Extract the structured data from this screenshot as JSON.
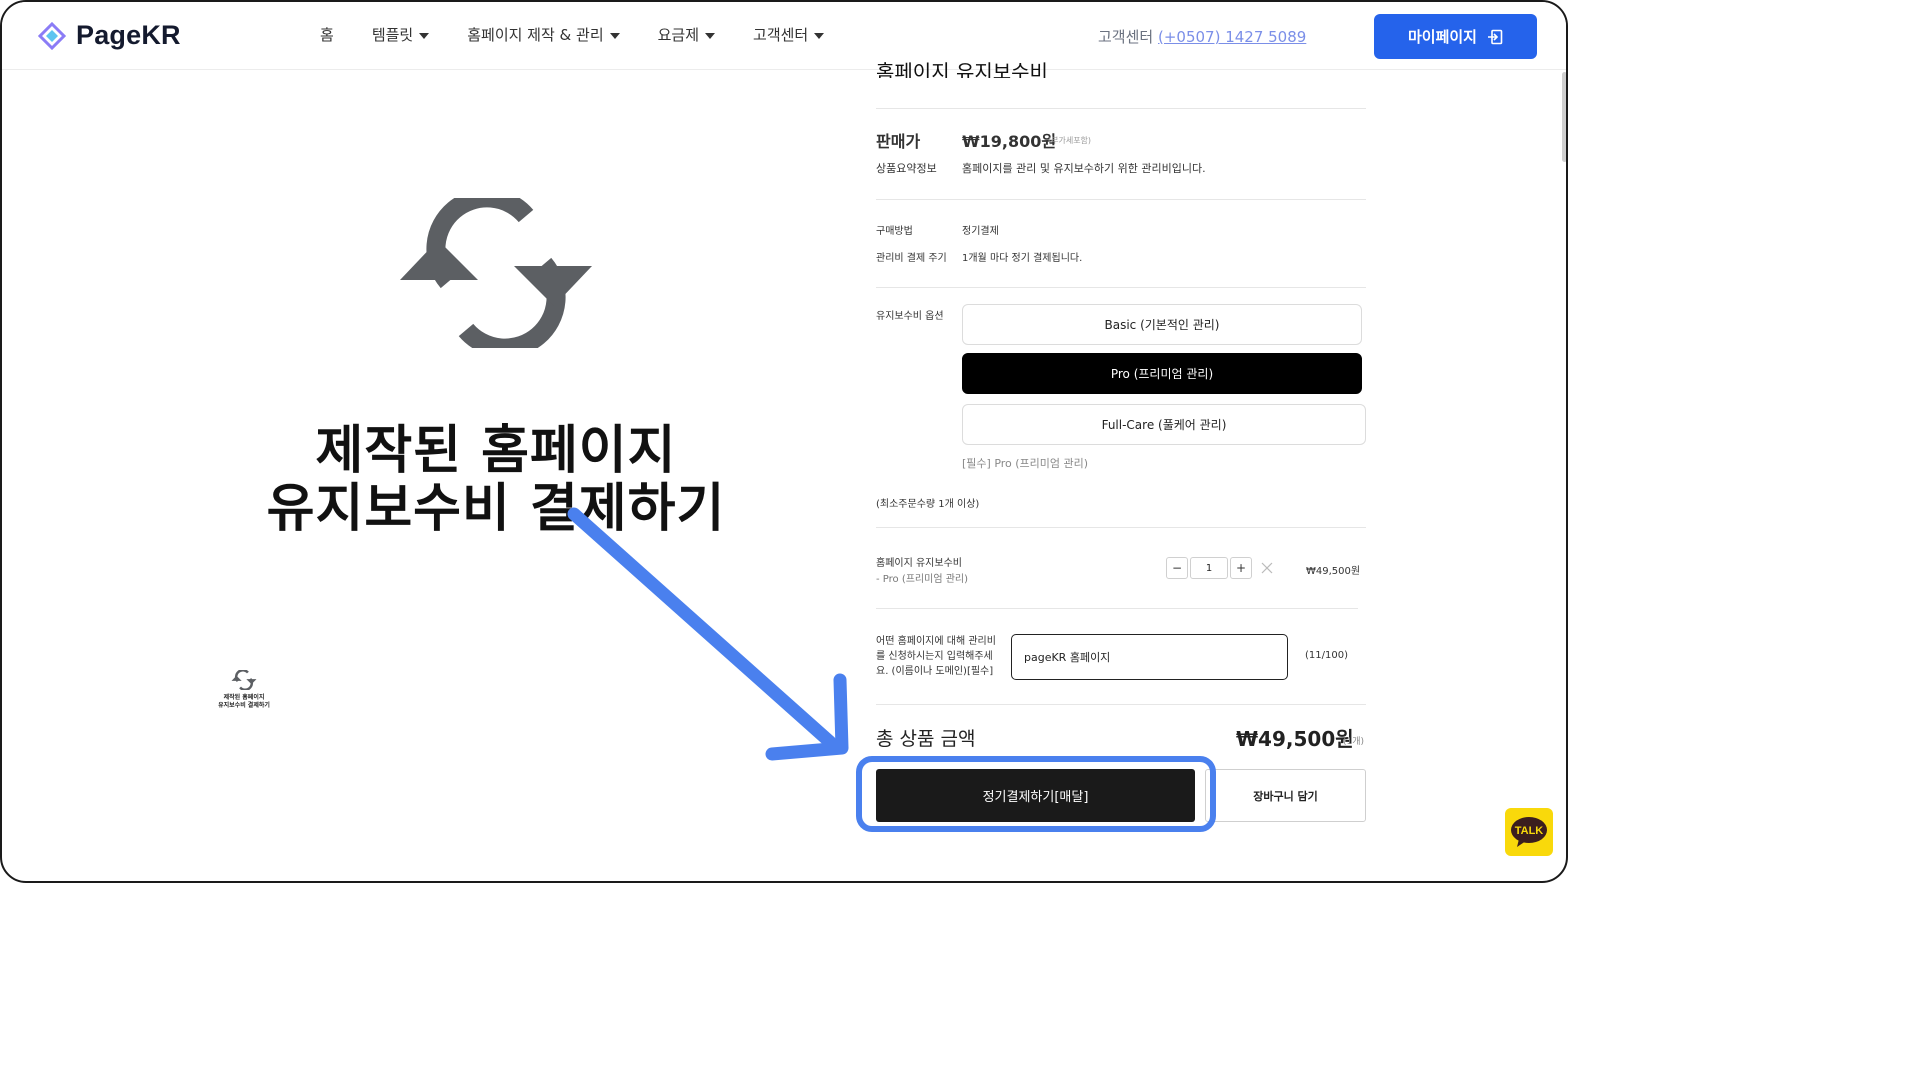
{
  "header": {
    "logo_text": "PageKR",
    "nav": [
      {
        "label": "홈",
        "dropdown": false
      },
      {
        "label": "템플릿",
        "dropdown": true
      },
      {
        "label": "홈페이지 제작 & 관리",
        "dropdown": true
      },
      {
        "label": "요금제",
        "dropdown": true
      },
      {
        "label": "고객센터",
        "dropdown": true
      }
    ],
    "cs_label": "고객센터",
    "cs_phone": "(+0507) 1427 5089",
    "mypage_label": "마이페이지",
    "accent_color": "#2563eb"
  },
  "hero": {
    "line1": "제작된 홈페이지",
    "line2": "유지보수비 결제하기",
    "icon": "refresh-icon"
  },
  "thumbnail": {
    "line1": "제작된 홈페이지",
    "line2": "유지보수비 결제하기"
  },
  "product": {
    "title": "홈페이지 유지보수비",
    "price_label": "판매가",
    "price_value": "₩19,800원",
    "vat_note": "(부가세포함)",
    "summary_label": "상품요약정보",
    "summary_value": "홈페이지를 관리 및 유지보수하기 위한 관리비입니다.",
    "purchase_method_label": "구매방법",
    "purchase_method_value": "정기결제",
    "cycle_label": "관리비 결제 주기",
    "cycle_value": "1개월 마다 정기 결제됩니다.",
    "options_label": "유지보수비 옵션",
    "options": [
      {
        "label": "Basic (기본적인 관리)",
        "selected": false
      },
      {
        "label": "Pro (프리미엄 관리)",
        "selected": true
      },
      {
        "label": "Full-Care (풀케어 관리)",
        "selected": false
      }
    ],
    "required_note": "[필수] Pro (프리미엄 관리)",
    "min_order": "(최소주문수량 1개 이상)",
    "cart_item_name": "홈페이지 유지보수비",
    "cart_item_option": "- Pro (프리미엄 관리)",
    "quantity": "1",
    "item_price": "₩49,500원",
    "question_label": "어떤 홈페이지에 대해 관리비를 신청하시는지 입력해주세요. (이름이나 도메인)[필수]",
    "question_value": "pageKR 홈페이지",
    "char_count": "(11/100)",
    "total_label": "총 상품 금액",
    "total_value": "₩49,500원",
    "total_count": "(1개)",
    "buy_label": "정기결제하기[매달]",
    "cart_label": "장바구니 담기"
  },
  "annotation": {
    "highlight_color": "#4a80ee"
  },
  "chat": {
    "label": "TALK",
    "color": "#f9d90b"
  }
}
